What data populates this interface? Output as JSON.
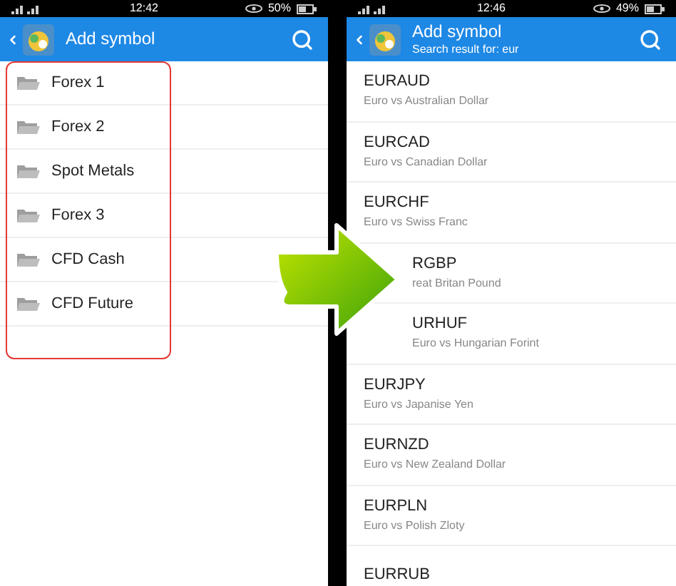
{
  "screens": [
    {
      "status_bar": {
        "time": "12:42",
        "battery": "50%"
      },
      "header": {
        "title": "Add symbol"
      },
      "folders": [
        {
          "label": "Forex 1"
        },
        {
          "label": "Forex 2"
        },
        {
          "label": "Spot Metals"
        },
        {
          "label": "Forex 3"
        },
        {
          "label": "CFD Cash"
        },
        {
          "label": "CFD Future"
        }
      ]
    },
    {
      "status_bar": {
        "time": "12:46",
        "battery": "49%"
      },
      "header": {
        "title": "Add symbol",
        "subtitle": "Search result for: eur"
      },
      "symbols": [
        {
          "name": "EURAUD",
          "description": "Euro vs Australian Dollar",
          "covered": false
        },
        {
          "name": "EURCAD",
          "description": "Euro vs Canadian Dollar",
          "covered": false
        },
        {
          "name": "EURCHF",
          "description": "Euro vs Swiss Franc",
          "covered": false
        },
        {
          "name": "RGBP",
          "description": "reat Britan Pound",
          "covered": true
        },
        {
          "name": "URHUF",
          "description": "Euro vs Hungarian Forint",
          "covered": true
        },
        {
          "name": "EURJPY",
          "description": "Euro vs Japanise Yen",
          "covered": false
        },
        {
          "name": "EURNZD",
          "description": "Euro vs New Zealand Dollar",
          "covered": false
        },
        {
          "name": "EURPLN",
          "description": "Euro vs Polish Zloty",
          "covered": false
        },
        {
          "name": "EURRUB",
          "covered": false
        }
      ]
    }
  ]
}
